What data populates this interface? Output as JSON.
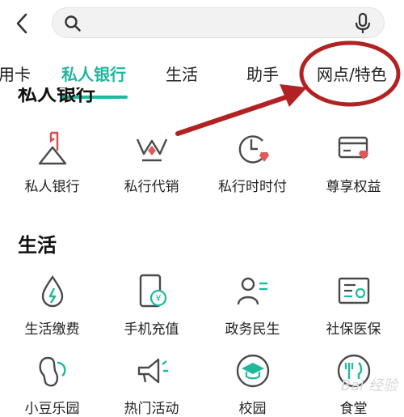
{
  "search": {
    "placeholder": ""
  },
  "tabs": [
    {
      "label": "用卡"
    },
    {
      "label": "私人银行"
    },
    {
      "label": "生活"
    },
    {
      "label": "助手"
    },
    {
      "label": "网点/特色"
    }
  ],
  "private_banking": {
    "title": "私人银行",
    "items": [
      {
        "label": "私人银行",
        "icon": "private-bank-icon"
      },
      {
        "label": "私行代销",
        "icon": "crown-icon"
      },
      {
        "label": "私行时时付",
        "icon": "clock-diamond-icon"
      },
      {
        "label": "尊享权益",
        "icon": "card-diamond-icon"
      }
    ]
  },
  "life": {
    "title": "生活",
    "items": [
      {
        "label": "生活缴费",
        "icon": "water-drop-bolt-icon"
      },
      {
        "label": "手机充值",
        "icon": "phone-yen-icon"
      },
      {
        "label": "政务民生",
        "icon": "person-lines-icon"
      },
      {
        "label": "社保医保",
        "icon": "id-card-icon"
      },
      {
        "label": "小豆乐园",
        "icon": "bean-icon"
      },
      {
        "label": "热门活动",
        "icon": "megaphone-icon"
      },
      {
        "label": "校园",
        "icon": "graduation-cap-icon"
      },
      {
        "label": "食堂",
        "icon": "utensils-icon"
      }
    ]
  },
  "colors": {
    "accent": "#1fb89c",
    "annotation": "#b22222",
    "icon_stroke": "#4a4a4a"
  }
}
